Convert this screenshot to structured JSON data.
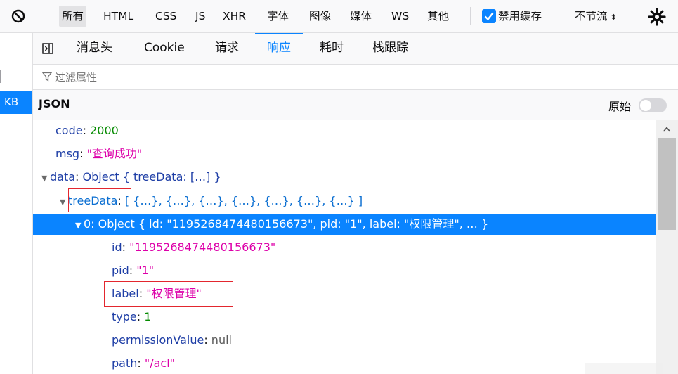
{
  "toolbar": {
    "filters": [
      "所有",
      "HTML",
      "CSS",
      "JS",
      "XHR",
      "字体",
      "图像",
      "媒体",
      "WS",
      "其他"
    ],
    "active_filter": "所有",
    "disable_cache_label": "禁用缓存",
    "disable_cache_checked": true,
    "throttle_label": "不节流",
    "throttle_arrow": "⬍"
  },
  "left_list": {
    "selected_text": "KB"
  },
  "detail_tabs": {
    "items": [
      "消息头",
      "Cookie",
      "请求",
      "响应",
      "耗时",
      "栈跟踪"
    ],
    "active": "响应"
  },
  "filter": {
    "placeholder": "过滤属性"
  },
  "json_header": {
    "title": "JSON",
    "raw_label": "原始",
    "raw_enabled": false
  },
  "tree": {
    "code": {
      "key": "code",
      "value": "2000"
    },
    "msg": {
      "key": "msg",
      "value": "\"查询成功\""
    },
    "data": {
      "key": "data",
      "preview": "Object { treeData: […] }"
    },
    "treeData": {
      "key": "treeData",
      "preview": "[ {…}, {…}, {…}, {…}, {…}, {…}, {…} ]"
    },
    "item0": {
      "key": "0",
      "preview": "Object { id: \"1195268474480156673\", pid: \"1\", label: \"权限管理\", … }"
    },
    "id": {
      "key": "id",
      "value": "\"1195268474480156673\""
    },
    "pid": {
      "key": "pid",
      "value": "\"1\""
    },
    "label": {
      "key": "label",
      "value": "\"权限管理\""
    },
    "type": {
      "key": "type",
      "value": "1"
    },
    "permissionValue": {
      "key": "permissionValue",
      "value": "null"
    },
    "path": {
      "key": "path",
      "value": "\"/acl\""
    }
  },
  "colors": {
    "accent": "#0a84ff",
    "key": "#1e3ea6",
    "number": "#058b00",
    "string": "#dd00a9",
    "annotation_box": "#e3262e"
  },
  "icons": [
    "block-icon",
    "checkbox-icon",
    "gear-icon",
    "panel-toggle-icon",
    "funnel-icon",
    "toggle-switch",
    "triangle-expanded-icon",
    "scroll-up-icon"
  ]
}
